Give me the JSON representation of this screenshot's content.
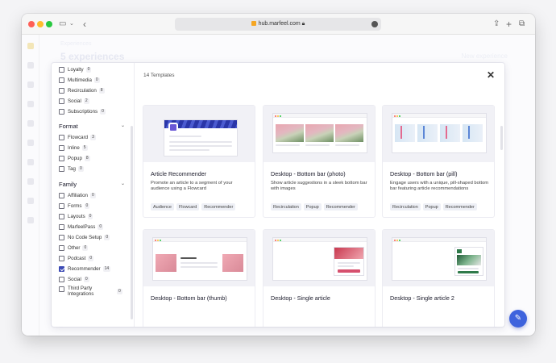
{
  "browser": {
    "url": "hub.marfeel.com",
    "lock_icon": "lock-icon",
    "icons": {
      "sidebar": "sidebar-icon",
      "back": "chevron-left-icon",
      "share": "share-icon",
      "new_tab": "plus-icon",
      "tabs": "tabs-icon"
    }
  },
  "background": {
    "subtitle": "Experiences",
    "title": "5 experiences",
    "button": "New experience"
  },
  "filters": {
    "top_items": [
      {
        "label": "Loyalty",
        "count": "0",
        "checked": false
      },
      {
        "label": "Multimedia",
        "count": "0",
        "checked": false
      },
      {
        "label": "Recirculation",
        "count": "8",
        "checked": false
      },
      {
        "label": "Social",
        "count": "2",
        "checked": false
      },
      {
        "label": "Subscriptions",
        "count": "0",
        "checked": false
      }
    ],
    "format": {
      "title": "Format",
      "items": [
        {
          "label": "Flowcard",
          "count": "3",
          "checked": false
        },
        {
          "label": "Inline",
          "count": "5",
          "checked": false
        },
        {
          "label": "Popup",
          "count": "8",
          "checked": false
        },
        {
          "label": "Tag",
          "count": "0",
          "checked": false
        }
      ]
    },
    "family": {
      "title": "Family",
      "items": [
        {
          "label": "Affiliation",
          "count": "0",
          "checked": false
        },
        {
          "label": "Forms",
          "count": "0",
          "checked": false
        },
        {
          "label": "Layouts",
          "count": "0",
          "checked": false
        },
        {
          "label": "MarfeelPass",
          "count": "0",
          "checked": false
        },
        {
          "label": "No Code Setup",
          "count": "0",
          "checked": false
        },
        {
          "label": "Other",
          "count": "0",
          "checked": false
        },
        {
          "label": "Podcast",
          "count": "0",
          "checked": false
        },
        {
          "label": "Recommender",
          "count": "14",
          "checked": true
        },
        {
          "label": "Social",
          "count": "0",
          "checked": false
        },
        {
          "label": "Third Party Integrations",
          "count": "0",
          "checked": false
        }
      ]
    }
  },
  "templates": {
    "count_label": "14 Templates",
    "cards": [
      {
        "title": "Article Recommender",
        "description": "Promote an article to a segment of your audience using a Flowcard",
        "tags": [
          "Audience",
          "Flowcard",
          "Recommender"
        ]
      },
      {
        "title": "Desktop - Bottom bar (photo)",
        "description": "Show article suggestions in a sleek bottom bar with images",
        "tags": [
          "Recirculation",
          "Popup",
          "Recommender"
        ]
      },
      {
        "title": "Desktop - Bottom bar (pill)",
        "description": "Engage users with a unique, pill-shaped bottom bar featuring article recommendations",
        "tags": [
          "Recirculation",
          "Popup",
          "Recommender"
        ]
      },
      {
        "title": "Desktop - Bottom bar (thumb)",
        "description": "",
        "tags": []
      },
      {
        "title": "Desktop - Single article",
        "description": "",
        "tags": []
      },
      {
        "title": "Desktop - Single article 2",
        "description": "",
        "tags": []
      }
    ]
  },
  "colors": {
    "accent": "#3e63dd",
    "checkbox_checked": "#3d4bb5"
  }
}
